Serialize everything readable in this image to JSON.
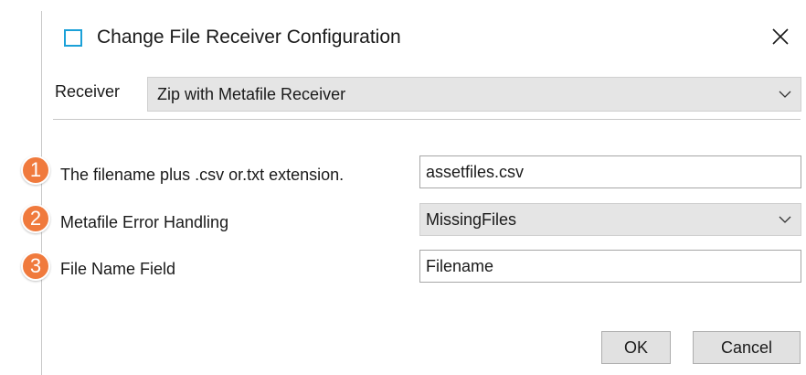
{
  "window": {
    "title": "Change File Receiver Configuration",
    "icon": "window-icon"
  },
  "receiver": {
    "label": "Receiver",
    "selected": "Zip with Metafile Receiver"
  },
  "fields": [
    {
      "badge": "1",
      "label": "The filename plus .csv or.txt extension.",
      "value": "assetfiles.csv",
      "type": "text"
    },
    {
      "badge": "2",
      "label": "Metafile Error Handling",
      "value": "MissingFiles",
      "type": "select"
    },
    {
      "badge": "3",
      "label": "File Name Field",
      "value": "Filename",
      "type": "text"
    }
  ],
  "buttons": {
    "ok": "OK",
    "cancel": "Cancel"
  },
  "colors": {
    "badge": "#f07a3d",
    "title_icon": "#1ba1d8",
    "select_bg": "#e5e5e5"
  }
}
